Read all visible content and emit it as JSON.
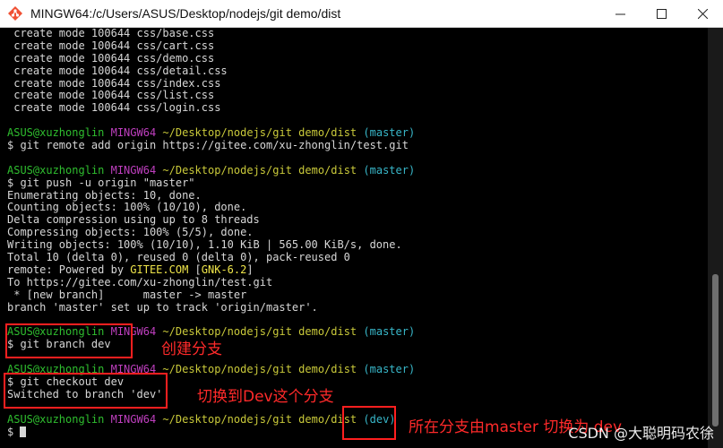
{
  "window": {
    "title": "MINGW64:/c/Users/ASUS/Desktop/nodejs/git demo/dist",
    "icons": {
      "app": "git-bash-icon",
      "minimize": "minimize-icon",
      "maximize": "maximize-icon",
      "close": "close-icon"
    }
  },
  "terminal": {
    "lines": [
      {
        "segments": [
          {
            "text": " create mode 100644 css/base.css",
            "c": ""
          }
        ]
      },
      {
        "segments": [
          {
            "text": " create mode 100644 css/cart.css",
            "c": ""
          }
        ]
      },
      {
        "segments": [
          {
            "text": " create mode 100644 css/demo.css",
            "c": ""
          }
        ]
      },
      {
        "segments": [
          {
            "text": " create mode 100644 css/detail.css",
            "c": ""
          }
        ]
      },
      {
        "segments": [
          {
            "text": " create mode 100644 css/index.css",
            "c": ""
          }
        ]
      },
      {
        "segments": [
          {
            "text": " create mode 100644 css/list.css",
            "c": ""
          }
        ]
      },
      {
        "segments": [
          {
            "text": " create mode 100644 css/login.css",
            "c": ""
          }
        ]
      },
      {
        "segments": [
          {
            "text": "",
            "c": ""
          }
        ]
      },
      {
        "segments": [
          {
            "text": "ASUS@xuzhonglin",
            "c": "u-host"
          },
          {
            "text": " ",
            "c": ""
          },
          {
            "text": "MINGW64",
            "c": "u-sys"
          },
          {
            "text": " ",
            "c": ""
          },
          {
            "text": "~/Desktop/nodejs/git demo/dist",
            "c": "u-path"
          },
          {
            "text": " ",
            "c": ""
          },
          {
            "text": "(master)",
            "c": "u-branch"
          }
        ]
      },
      {
        "segments": [
          {
            "text": "$ git remote add origin https://gitee.com/xu-zhonglin/test.git",
            "c": ""
          }
        ]
      },
      {
        "segments": [
          {
            "text": "",
            "c": ""
          }
        ]
      },
      {
        "segments": [
          {
            "text": "ASUS@xuzhonglin",
            "c": "u-host"
          },
          {
            "text": " ",
            "c": ""
          },
          {
            "text": "MINGW64",
            "c": "u-sys"
          },
          {
            "text": " ",
            "c": ""
          },
          {
            "text": "~/Desktop/nodejs/git demo/dist",
            "c": "u-path"
          },
          {
            "text": " ",
            "c": ""
          },
          {
            "text": "(master)",
            "c": "u-branch"
          }
        ]
      },
      {
        "segments": [
          {
            "text": "$ git push -u origin \"master\"",
            "c": ""
          }
        ]
      },
      {
        "segments": [
          {
            "text": "Enumerating objects: 10, done.",
            "c": ""
          }
        ]
      },
      {
        "segments": [
          {
            "text": "Counting objects: 100% (10/10), done.",
            "c": ""
          }
        ]
      },
      {
        "segments": [
          {
            "text": "Delta compression using up to 8 threads",
            "c": ""
          }
        ]
      },
      {
        "segments": [
          {
            "text": "Compressing objects: 100% (5/5), done.",
            "c": ""
          }
        ]
      },
      {
        "segments": [
          {
            "text": "Writing objects: 100% (10/10), 1.10 KiB | 565.00 KiB/s, done.",
            "c": ""
          }
        ]
      },
      {
        "segments": [
          {
            "text": "Total 10 (delta 0), reused 0 (delta 0), pack-reused 0",
            "c": ""
          }
        ]
      },
      {
        "segments": [
          {
            "text": "remote: Powered by ",
            "c": ""
          },
          {
            "text": "GITEE.COM",
            "c": "u-gitee"
          },
          {
            "text": " [",
            "c": ""
          },
          {
            "text": "GNK-6.2",
            "c": "u-gitee"
          },
          {
            "text": "]",
            "c": ""
          }
        ]
      },
      {
        "segments": [
          {
            "text": "To https://gitee.com/xu-zhonglin/test.git",
            "c": ""
          }
        ]
      },
      {
        "segments": [
          {
            "text": " * [new branch]      master -> master",
            "c": ""
          }
        ]
      },
      {
        "segments": [
          {
            "text": "branch 'master' set up to track 'origin/master'.",
            "c": ""
          }
        ]
      },
      {
        "segments": [
          {
            "text": "",
            "c": ""
          }
        ]
      },
      {
        "segments": [
          {
            "text": "ASUS@xuzhonglin",
            "c": "u-host"
          },
          {
            "text": " ",
            "c": ""
          },
          {
            "text": "MINGW64",
            "c": "u-sys"
          },
          {
            "text": " ",
            "c": ""
          },
          {
            "text": "~/Desktop/nodejs/git demo/dist",
            "c": "u-path"
          },
          {
            "text": " ",
            "c": ""
          },
          {
            "text": "(master)",
            "c": "u-branch"
          }
        ]
      },
      {
        "segments": [
          {
            "text": "$ git branch dev",
            "c": ""
          }
        ]
      },
      {
        "segments": [
          {
            "text": "",
            "c": ""
          }
        ]
      },
      {
        "segments": [
          {
            "text": "ASUS@xuzhonglin",
            "c": "u-host"
          },
          {
            "text": " ",
            "c": ""
          },
          {
            "text": "MINGW64",
            "c": "u-sys"
          },
          {
            "text": " ",
            "c": ""
          },
          {
            "text": "~/Desktop/nodejs/git demo/dist",
            "c": "u-path"
          },
          {
            "text": " ",
            "c": ""
          },
          {
            "text": "(master)",
            "c": "u-branch"
          }
        ]
      },
      {
        "segments": [
          {
            "text": "$ git checkout dev",
            "c": ""
          }
        ]
      },
      {
        "segments": [
          {
            "text": "Switched to branch 'dev'",
            "c": ""
          }
        ]
      },
      {
        "segments": [
          {
            "text": "",
            "c": ""
          }
        ]
      },
      {
        "segments": [
          {
            "text": "ASUS@xuzhonglin",
            "c": "u-host"
          },
          {
            "text": " ",
            "c": ""
          },
          {
            "text": "MINGW64",
            "c": "u-sys"
          },
          {
            "text": " ",
            "c": ""
          },
          {
            "text": "~/Desktop/nodejs/git demo/dist",
            "c": "u-path"
          },
          {
            "text": " ",
            "c": ""
          },
          {
            "text": "(dev)",
            "c": "u-branch"
          }
        ]
      },
      {
        "segments": [
          {
            "text": "$ ",
            "c": ""
          }
        ]
      }
    ]
  },
  "annotations": {
    "branch_note": "创建分支",
    "checkout_note": "切换到Dev这个分支",
    "current_note": "所在分支由master 切换为 dev"
  },
  "watermark": "CSDN @大聪明码农徐",
  "colors": {
    "annotation": "#ff1f1f",
    "host": "#2fbf2f",
    "mingw": "#bf3fbf",
    "path": "#c9c93a",
    "branch": "#38b7c9"
  }
}
